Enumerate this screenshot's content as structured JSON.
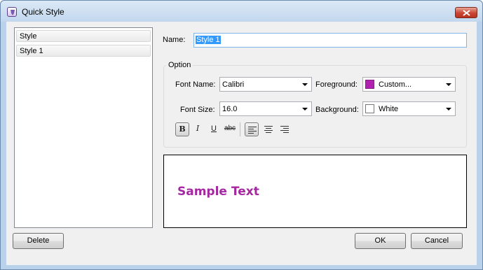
{
  "window": {
    "title": "Quick Style"
  },
  "style_list": {
    "items": [
      "Style",
      "Style 1"
    ],
    "selected": "Style 1"
  },
  "name": {
    "label": "Name:",
    "value": "Style 1"
  },
  "option": {
    "legend": "Option",
    "font_name": {
      "label": "Font Name:",
      "value": "Calibri"
    },
    "font_size": {
      "label": "Font Size:",
      "value": "16.0"
    },
    "foreground": {
      "label": "Foreground:",
      "value": "Custom...",
      "color": "#b121b0"
    },
    "background": {
      "label": "Background:",
      "value": "White",
      "color": "#ffffff"
    },
    "format_buttons": {
      "bold": "B",
      "italic": "I",
      "underline": "U",
      "strikethrough": "abc"
    }
  },
  "preview": {
    "text": "Sample Text",
    "color": "#a4289f"
  },
  "buttons": {
    "delete": "Delete",
    "ok": "OK",
    "cancel": "Cancel"
  }
}
